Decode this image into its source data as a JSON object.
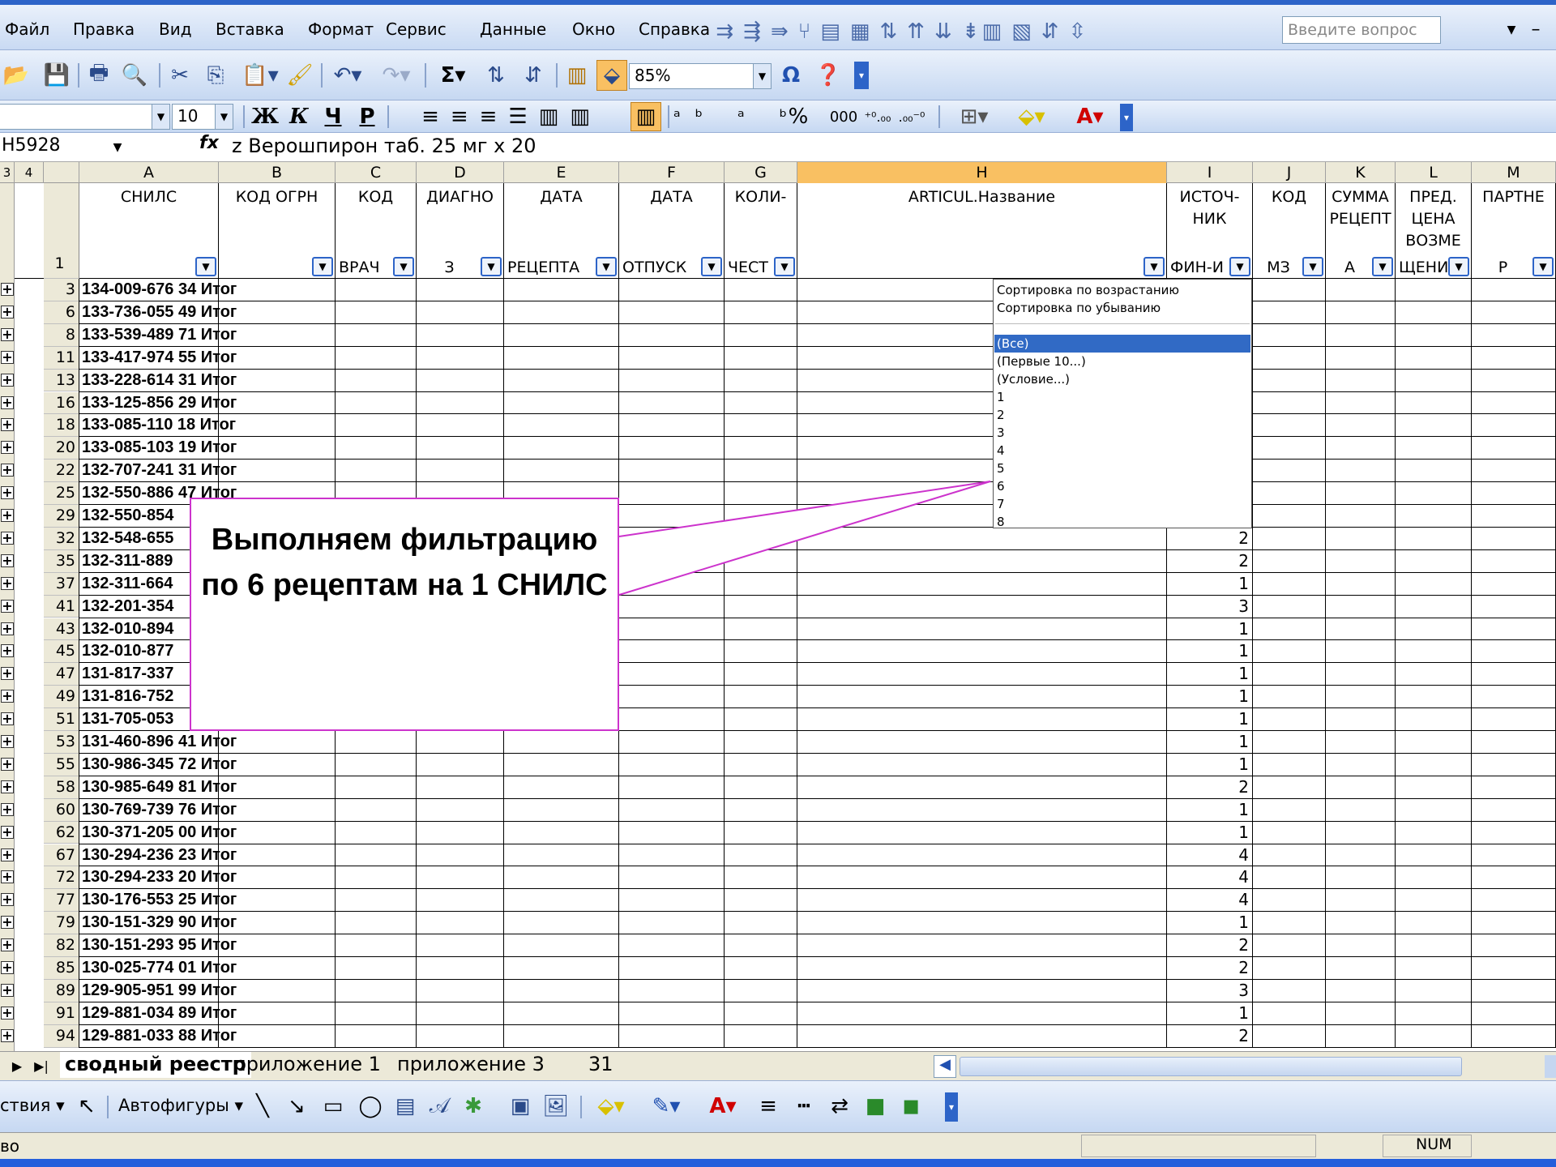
{
  "menu": [
    "Файл",
    "Правка",
    "Вид",
    "Вставка",
    "Формат",
    "Сервис",
    "Данные",
    "Окно",
    "Справка"
  ],
  "ask_placeholder": "Введите вопрос",
  "zoom": "85%",
  "font_size": "10",
  "font_name": "",
  "name_box": "H5928",
  "formula": "z Верошпирон таб. 25 мг x 20",
  "fx": "fx",
  "outline_levels": [
    "3",
    "4"
  ],
  "columns": [
    "A",
    "B",
    "C",
    "D",
    "E",
    "F",
    "G",
    "H",
    "I",
    "J",
    "K",
    "L",
    "M"
  ],
  "header_row": {
    "row_no": "1",
    "cells": [
      {
        "top": "СНИЛС",
        "bottom": ""
      },
      {
        "top": "КОД ОГРН",
        "bottom": ""
      },
      {
        "top": "КОД",
        "bottom": "ВРАЧ"
      },
      {
        "top": "ДИАГНО",
        "bottom": "З"
      },
      {
        "top": "ДАТА",
        "bottom": "РЕЦЕПТА"
      },
      {
        "top": "ДАТА",
        "bottom": "ОТПУСК"
      },
      {
        "top": "КОЛИ-",
        "bottom": "ЧЕСТ"
      },
      {
        "top": "ARTICUL.Название",
        "bottom": ""
      },
      {
        "top": "ИСТОЧ-\nНИК",
        "bottom": "ФИН-И"
      },
      {
        "top": "КОД",
        "bottom": "МЗ"
      },
      {
        "top": "СУММА\nРЕЦЕПТ",
        "bottom": "А"
      },
      {
        "top": "ПРЕД.\nЦЕНА\nВОЗМЕ",
        "bottom": "ЩЕНИ"
      },
      {
        "top": "ПАРТНЕ",
        "bottom": "Р"
      }
    ]
  },
  "rows": [
    {
      "n": "3",
      "a": "134-009-676 34 Итог",
      "i": ""
    },
    {
      "n": "6",
      "a": "133-736-055 49 Итог",
      "i": ""
    },
    {
      "n": "8",
      "a": "133-539-489 71 Итог",
      "i": ""
    },
    {
      "n": "11",
      "a": "133-417-974 55 Итог",
      "i": ""
    },
    {
      "n": "13",
      "a": "133-228-614 31 Итог",
      "i": ""
    },
    {
      "n": "16",
      "a": "133-125-856 29 Итог",
      "i": ""
    },
    {
      "n": "18",
      "a": "133-085-110 18 Итог",
      "i": ""
    },
    {
      "n": "20",
      "a": "133-085-103 19 Итог",
      "i": ""
    },
    {
      "n": "22",
      "a": "132-707-241 31 Итог",
      "i": ""
    },
    {
      "n": "25",
      "a": "132-550-886 47 Итог",
      "i": ""
    },
    {
      "n": "29",
      "a": "132-550-854",
      "i": ""
    },
    {
      "n": "32",
      "a": "132-548-655",
      "i": "2"
    },
    {
      "n": "35",
      "a": "132-311-889",
      "i": "2"
    },
    {
      "n": "37",
      "a": "132-311-664",
      "i": "1"
    },
    {
      "n": "41",
      "a": "132-201-354",
      "i": "3"
    },
    {
      "n": "43",
      "a": "132-010-894",
      "i": "1"
    },
    {
      "n": "45",
      "a": "132-010-877",
      "i": "1"
    },
    {
      "n": "47",
      "a": "131-817-337",
      "i": "1"
    },
    {
      "n": "49",
      "a": "131-816-752",
      "i": "1"
    },
    {
      "n": "51",
      "a": "131-705-053",
      "i": "1"
    },
    {
      "n": "53",
      "a": "131-460-896 41 Итог",
      "i": "1"
    },
    {
      "n": "55",
      "a": "130-986-345 72 Итог",
      "i": "1"
    },
    {
      "n": "58",
      "a": "130-985-649 81 Итог",
      "i": "2"
    },
    {
      "n": "60",
      "a": "130-769-739 76 Итог",
      "i": "1"
    },
    {
      "n": "62",
      "a": "130-371-205 00 Итог",
      "i": "1"
    },
    {
      "n": "67",
      "a": "130-294-236 23 Итог",
      "i": "4"
    },
    {
      "n": "72",
      "a": "130-294-233 20 Итог",
      "i": "4"
    },
    {
      "n": "77",
      "a": "130-176-553 25 Итог",
      "i": "4"
    },
    {
      "n": "79",
      "a": "130-151-329 90 Итог",
      "i": "1"
    },
    {
      "n": "82",
      "a": "130-151-293 95 Итог",
      "i": "2"
    },
    {
      "n": "85",
      "a": "130-025-774 01 Итог",
      "i": "2"
    },
    {
      "n": "89",
      "a": "129-905-951 99 Итог",
      "i": "3"
    },
    {
      "n": "91",
      "a": "129-881-034 89 Итог",
      "i": "1"
    },
    {
      "n": "94",
      "a": "129-881-033 88 Итог",
      "i": "2"
    }
  ],
  "dropdown": {
    "sort_asc": "Сортировка по возрастанию",
    "sort_desc": "Сортировка по убыванию",
    "all": "(Все)",
    "top10": "(Первые 10...)",
    "condition": "(Условие...)",
    "values": [
      "1",
      "2",
      "3",
      "4",
      "5",
      "6",
      "7",
      "8"
    ]
  },
  "callout": "Выполняем фильтрацию по 6 рецептам на 1 СНИЛС",
  "sheet_tabs": [
    "сводный реестр",
    "приложение 1",
    "приложение 3",
    "31"
  ],
  "draw_toolbar": {
    "actions": "ствия",
    "autoshapes": "Автофигуры"
  },
  "status": {
    "left": "во",
    "num": "NUM"
  }
}
